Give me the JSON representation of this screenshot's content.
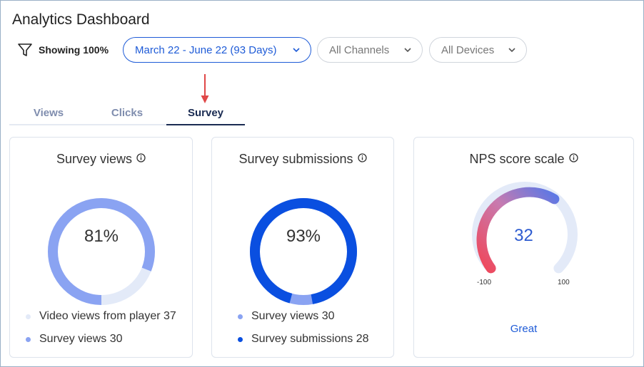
{
  "header": {
    "title": "Analytics Dashboard"
  },
  "filters": {
    "showing_label": "Showing 100%",
    "date_range": "March 22 - June 22 (93 Days)",
    "channels": "All Channels",
    "devices": "All Devices"
  },
  "tabs": [
    {
      "label": "Views",
      "active": false
    },
    {
      "label": "Clicks",
      "active": false
    },
    {
      "label": "Survey",
      "active": true
    }
  ],
  "cards": {
    "survey_views": {
      "title": "Survey views",
      "percent_label": "81%",
      "percent": 81,
      "legend": [
        {
          "label": "Video views from player 37",
          "color": "#e3eaf8"
        },
        {
          "label": "Survey views 30",
          "color": "#8aa3f2"
        }
      ]
    },
    "survey_submissions": {
      "title": "Survey submissions",
      "percent_label": "93%",
      "percent": 93,
      "legend": [
        {
          "label": "Survey views 30",
          "color": "#8aa3f2"
        },
        {
          "label": "Survey submissions 28",
          "color": "#0a4fe0"
        }
      ]
    },
    "nps": {
      "title": "NPS score scale",
      "score": "32",
      "min": "-100",
      "max": "100",
      "rating": "Great"
    }
  },
  "colors": {
    "accent": "#1e5bd7",
    "arrow": "#e04848",
    "track": "#e3eaf8",
    "views_ring": "#8aa3f2",
    "submissions_ring": "#0a4fe0"
  }
}
